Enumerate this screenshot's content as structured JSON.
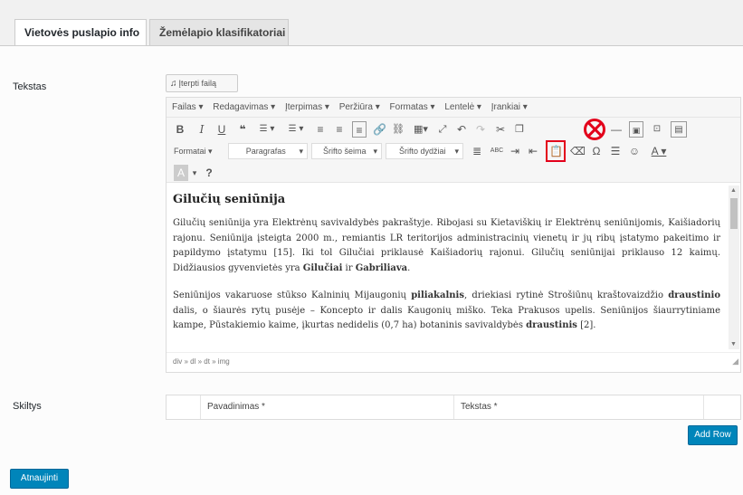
{
  "tabs": [
    {
      "label": "Vietovės puslapio info",
      "active": true
    },
    {
      "label": "Žemėlapio klasifikatoriai",
      "active": false
    }
  ],
  "fields": {
    "tekstas_label": "Tekstas",
    "skiltys_label": "Skiltys"
  },
  "media_button": {
    "label": "Įterpti failą"
  },
  "editor": {
    "menubar": [
      "Failas ▾",
      "Redagavimas ▾",
      "Įterpimas ▾",
      "Peržiūra ▾",
      "Formatas ▾",
      "Lentelė ▾",
      "Įrankiai ▾"
    ],
    "toolbar": {
      "format_select": "Formatai ▾",
      "paragraph_select": "Paragrafas",
      "font_family_select": "Šrifto šeima",
      "font_size_select": "Šrifto dydžiai"
    },
    "content": {
      "heading": "Gilučių seniūnija",
      "p1_a": "Gilučių seniūnija yra Elektrėnų savivaldybės pakraštyje. Ribojasi su Kietaviškių ir Elektrėnų seniūnijomis, Kaišiadorių rajonu. Seniūnija įsteigta 2000 m., remiantis LR teritorijos administracinių vienetų ir jų ribų įstatymo pakeitimo ir papildymo įstatymu [15]. Iki tol Gilučiai priklausė Kaišiadorių rajonui. Gilučių seniūnijai priklauso 12 kaimų. Didžiausios gyvenvietės yra ",
      "p1_b1": "Gilučiai",
      "p1_and": " ir ",
      "p1_b2": "Gabriliava",
      "p1_end": ".",
      "p2_a": "Seniūnijos vakaruose stūkso Kalninių Mijaugonių ",
      "p2_b1": "piliakalnis",
      "p2_mid": ", driekiasi rytinė Strošiūnų kraštovaizdžio ",
      "p2_b2": "draustinio",
      "p2_c": " dalis, o šiaurės rytų pusėje – Koncepto ir dalis Kaugonių miško. Teka Prakusos upelis. Seniūnijos šiaurrytiniame kampe, Pūstakiemio kaime, įkurtas nedidelis (0,7 ha) botaninis savivaldybės ",
      "p2_b3": "draustinis",
      "p2_end": " [2]."
    },
    "statusbar": "div » dl » dt » img"
  },
  "table": {
    "columns": [
      "Pavadinimas *",
      "Tekstas *"
    ]
  },
  "buttons": {
    "add_row": "Add Row",
    "update": "Atnaujinti"
  },
  "colors": {
    "primary": "#0085ba",
    "highlight": "#e3001b"
  }
}
